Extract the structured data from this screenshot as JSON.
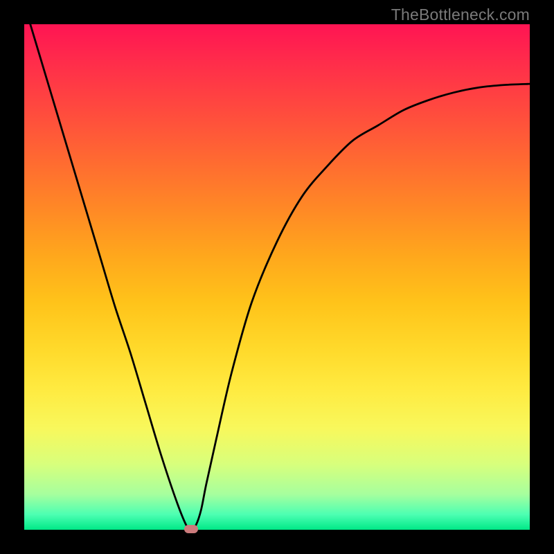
{
  "watermark": "TheBottleneck.com",
  "colors": {
    "frame": "#000000",
    "curve": "#000000",
    "marker": "#cc7b7c"
  },
  "chart_data": {
    "type": "line",
    "title": "",
    "xlabel": "",
    "ylabel": "",
    "xlim": [
      0,
      100
    ],
    "ylim": [
      0,
      100
    ],
    "grid": false,
    "legend": false,
    "annotations": [
      {
        "text": "TheBottleneck.com",
        "role": "watermark",
        "position": "top-right"
      }
    ],
    "series": [
      {
        "name": "bottleneck-curve",
        "x": [
          0,
          3,
          6,
          9,
          12,
          15,
          18,
          21,
          24,
          27,
          30,
          32,
          33,
          34,
          35,
          36,
          38,
          41,
          45,
          50,
          55,
          60,
          65,
          70,
          75,
          80,
          85,
          90,
          95,
          100
        ],
        "values": [
          104,
          94,
          84,
          74,
          64,
          54,
          44,
          35,
          25,
          15,
          6,
          1,
          0,
          1,
          4,
          9,
          18,
          31,
          45,
          57,
          66,
          72,
          77,
          80,
          83,
          85,
          86.5,
          87.5,
          88,
          88.2
        ]
      }
    ],
    "markers": [
      {
        "name": "minimum-point",
        "x": 33,
        "y": 0
      }
    ],
    "gradient_stops": [
      {
        "pct": 0,
        "color": "#ff1453"
      },
      {
        "pct": 50,
        "color": "#ffc31a"
      },
      {
        "pct": 80,
        "color": "#f8f85c"
      },
      {
        "pct": 100,
        "color": "#00e887"
      }
    ]
  }
}
